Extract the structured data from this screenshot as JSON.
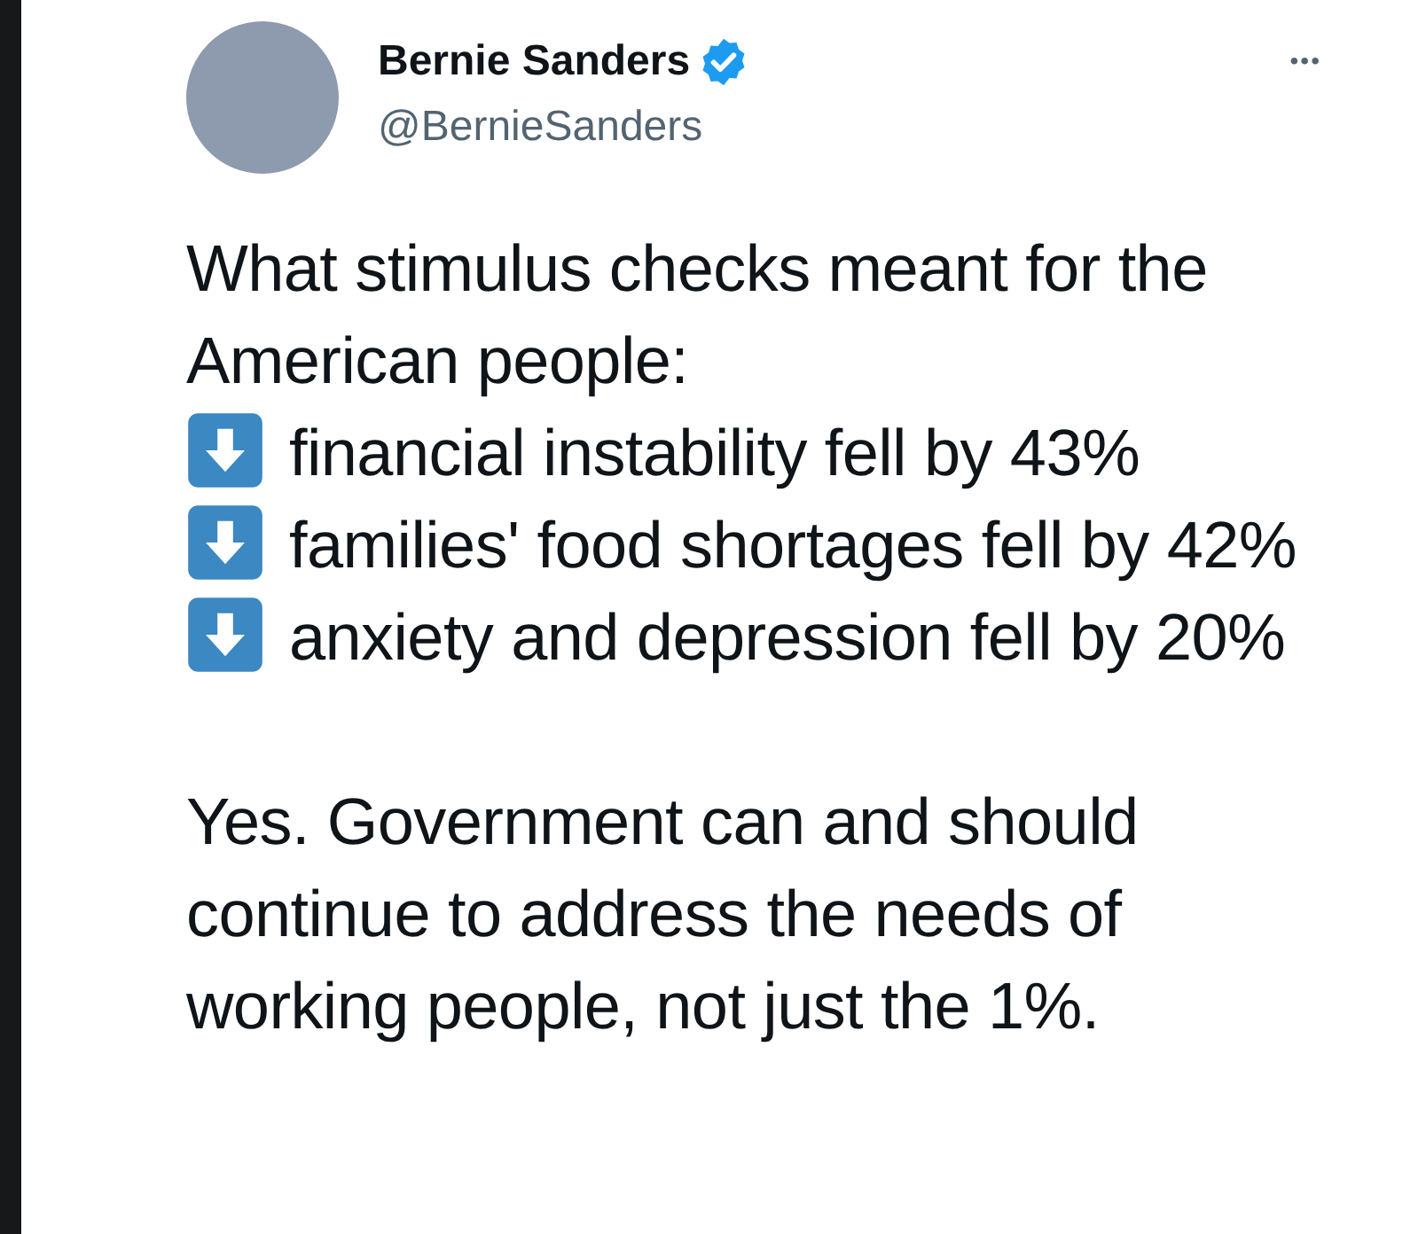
{
  "author": {
    "name": "Bernie Sanders",
    "verified": true,
    "handle": "@BernieSanders"
  },
  "more_menu": "•••",
  "intro": "What stimulus checks meant for the American people:",
  "points": [
    {
      "text": "financial instability fell by 43%"
    },
    {
      "text": "families' food shortages fell by 42%"
    },
    {
      "text": "anxiety and depression fell by 20%"
    }
  ],
  "closing": "Yes. Government can and should continue to address the needs of working people, not just the 1%."
}
